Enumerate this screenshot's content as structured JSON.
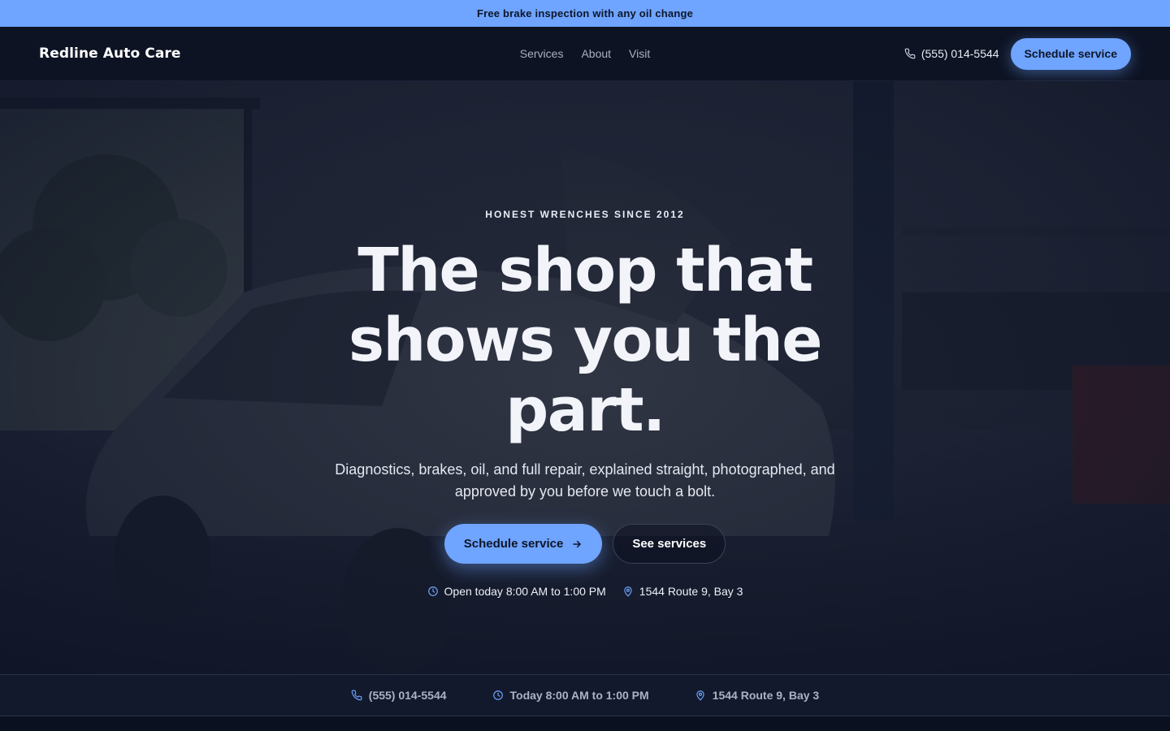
{
  "promo": {
    "text": "Free brake inspection with any oil change"
  },
  "nav": {
    "logo": "Redline Auto Care",
    "links": [
      "Services",
      "About",
      "Visit"
    ],
    "phone": "(555) 014-5544",
    "cta": "Schedule service"
  },
  "hero": {
    "eyebrow": "HONEST WRENCHES SINCE 2012",
    "headline": "The shop that shows you the part.",
    "subtext": "Diagnostics, brakes, oil, and full repair, explained straight, photographed, and approved by you before we touch a bolt.",
    "primary_cta": "Schedule service",
    "secondary_cta": "See services",
    "hours": "Open today 8:00 AM to 1:00 PM",
    "address": "1544 Route 9, Bay 3"
  },
  "infobar": {
    "phone": "(555) 014-5544",
    "hours": "Today 8:00 AM to 1:00 PM",
    "address": "1544 Route 9, Bay 3"
  },
  "colors": {
    "accent": "#6fa4ff",
    "navy": "#0d1323",
    "icon_blue": "#6fa4ff"
  }
}
